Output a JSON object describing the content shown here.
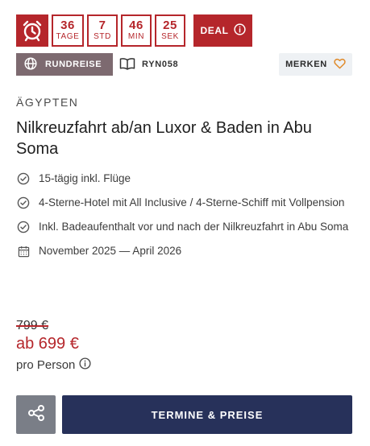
{
  "countdown": {
    "units": [
      {
        "value": "36",
        "label": "TAGE"
      },
      {
        "value": "7",
        "label": "STD"
      },
      {
        "value": "46",
        "label": "MIN"
      },
      {
        "value": "25",
        "label": "SEK"
      }
    ],
    "deal_label": "DEAL"
  },
  "tags": {
    "trip_type": "RUNDREISE",
    "trip_code": "RYN058",
    "favorite_label": "MERKEN"
  },
  "offer": {
    "country": "ÄGYPTEN",
    "title": "Nilkreuzfahrt ab/an Luxor & Baden in Abu Soma",
    "features": [
      {
        "icon": "check-circle-icon",
        "text": "15-tägig inkl. Flüge"
      },
      {
        "icon": "check-circle-icon",
        "text": "4-Sterne-Hotel mit All Inclusive / 4-Sterne-Schiff mit Vollpension"
      },
      {
        "icon": "check-circle-icon",
        "text": "Inkl. Badeaufenthalt vor und nach der Nilkreuzfahrt in Abu Soma"
      },
      {
        "icon": "calendar-icon",
        "text": "November 2025 — April 2026"
      }
    ]
  },
  "pricing": {
    "old_price": "799 €",
    "new_price": "ab 699 €",
    "per_person": "pro Person"
  },
  "actions": {
    "primary_label": "TERMINE & PREISE"
  },
  "colors": {
    "accent_red": "#b5262b",
    "trip_tag": "#7d6a70",
    "primary_button": "#27315a",
    "share_button": "#7a7e87",
    "heart": "#e08a2a"
  }
}
